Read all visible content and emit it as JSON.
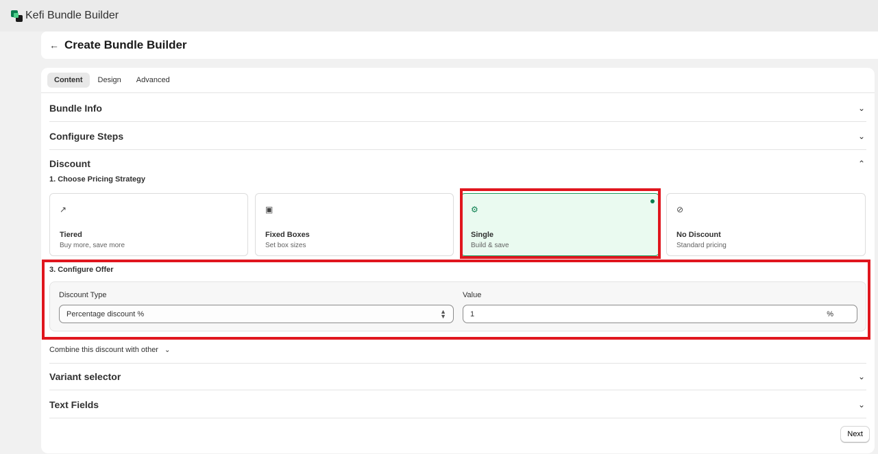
{
  "app": {
    "title": "Kefi Bundle Builder"
  },
  "page": {
    "title": "Create Bundle Builder"
  },
  "tabs": [
    {
      "label": "Content",
      "active": true
    },
    {
      "label": "Design",
      "active": false
    },
    {
      "label": "Advanced",
      "active": false
    }
  ],
  "sections": {
    "bundle_info": "Bundle Info",
    "configure_steps": "Configure Steps",
    "discount": "Discount",
    "variant_selector": "Variant selector",
    "text_fields": "Text Fields"
  },
  "discount": {
    "choose_strategy_heading": "1. Choose Pricing Strategy",
    "strategies": [
      {
        "title": "Tiered",
        "description": "Buy more, save more",
        "icon": "trend-up-icon",
        "selected": false
      },
      {
        "title": "Fixed Boxes",
        "description": "Set box sizes",
        "icon": "box-icon",
        "selected": false
      },
      {
        "title": "Single",
        "description": "Build & save",
        "icon": "discount-badge-icon",
        "selected": true
      },
      {
        "title": "No Discount",
        "description": "Standard pricing",
        "icon": "prohibited-icon",
        "selected": false
      }
    ],
    "configure_offer_heading": "3. Configure Offer",
    "discount_type_label": "Discount Type",
    "discount_type_value": "Percentage discount %",
    "value_label": "Value",
    "value": "1",
    "value_suffix": "%",
    "combine_label": "Combine this discount with other"
  },
  "footer": {
    "next_label": "Next"
  },
  "colors": {
    "accent": "#0a7d4e",
    "selected_bg": "#eafaf0",
    "highlight": "#e0161e"
  }
}
